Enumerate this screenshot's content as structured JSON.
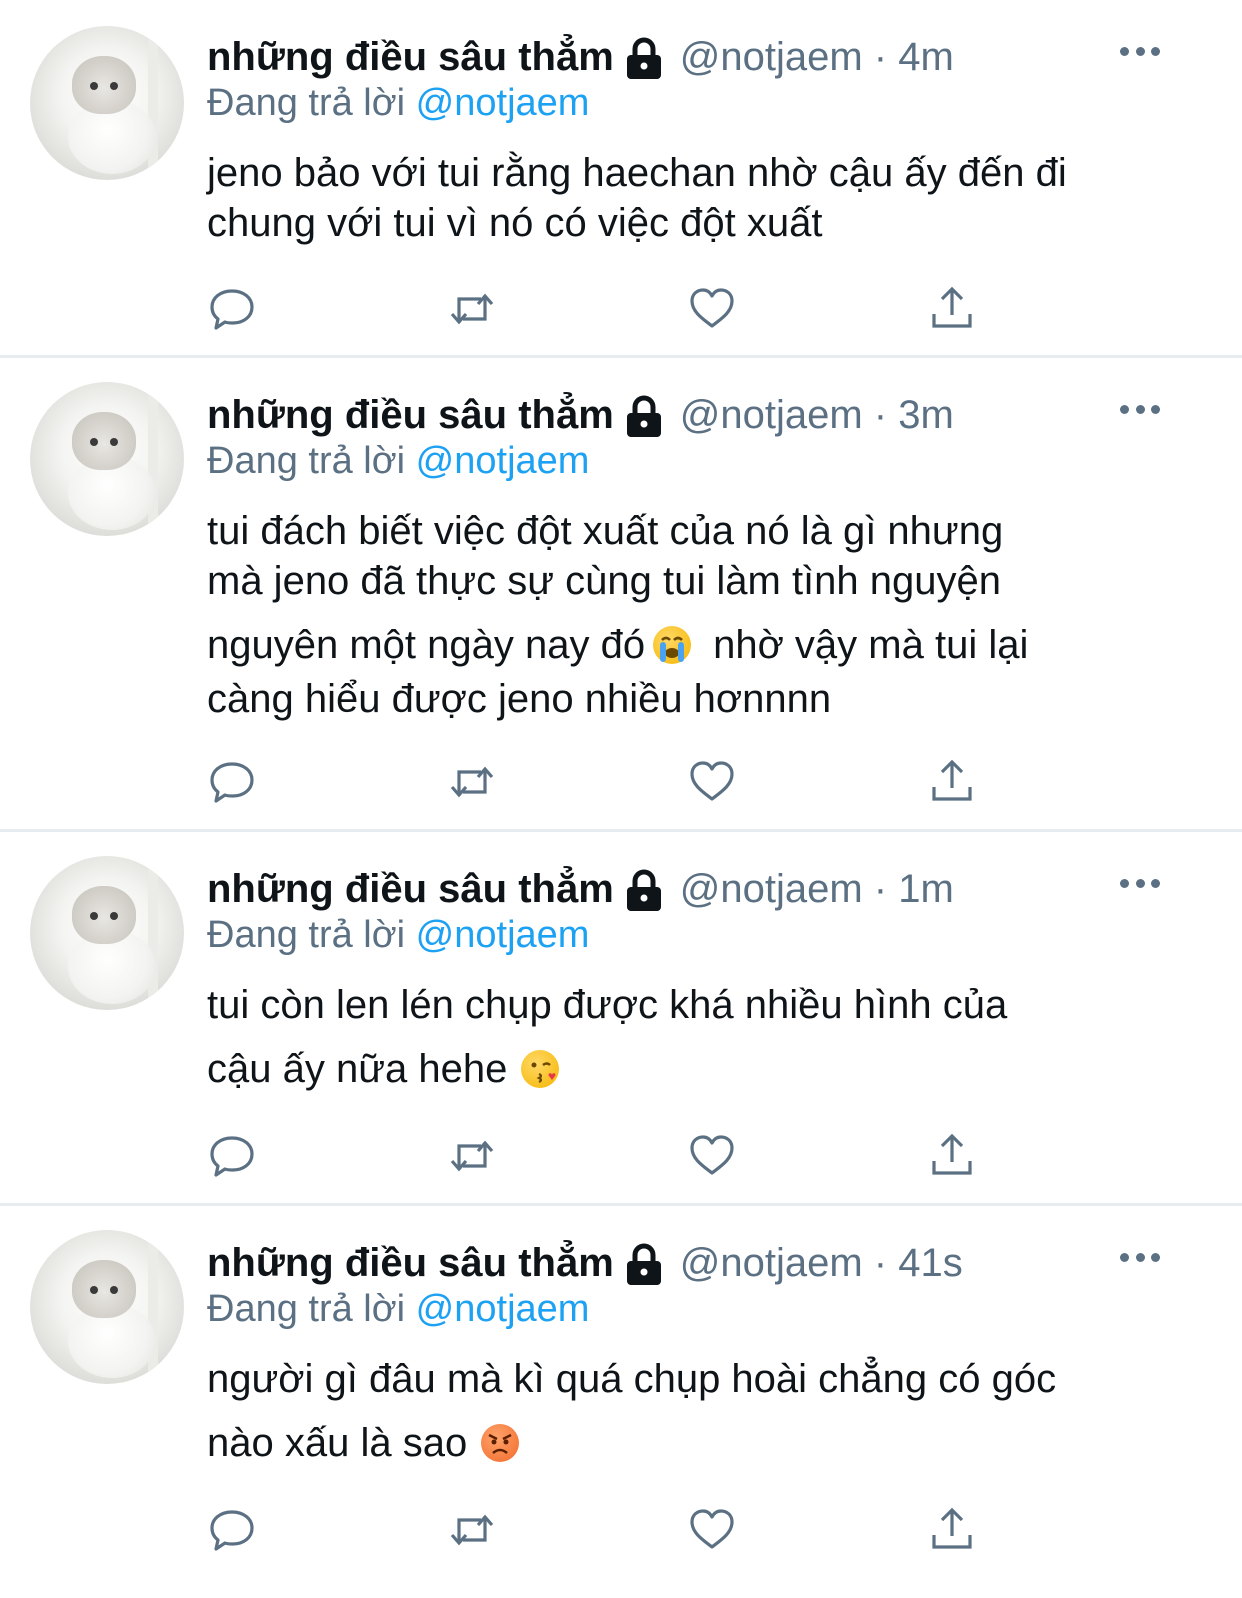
{
  "tweets": [
    {
      "name": "những điều sâu thẳm",
      "handle_time": "@notjaem · 4m",
      "reply_prefix": "Đang trả lời",
      "reply_mention": "@notjaem",
      "lines": [
        "jeno bảo với tui rằng haechan nhờ cậu ấy đến đi",
        "chung với tui vì nó có việc đột xuất"
      ],
      "emoji": ""
    },
    {
      "name": "những điều sâu thẳm",
      "handle_time": "@notjaem · 3m",
      "reply_prefix": "Đang trả lời",
      "reply_mention": "@notjaem",
      "lines": [
        "tui đách biết việc đột xuất của nó là gì nhưng",
        "mà jeno đã thực sự cùng tui làm tình nguyện",
        "nguyên một ngày nay đó",
        "nhờ vậy mà tui lại",
        "càng hiểu được jeno nhiều hơnnnn"
      ],
      "emoji": "loudly-crying-face"
    },
    {
      "name": "những điều sâu thẳm",
      "handle_time": "@notjaem · 1m",
      "reply_prefix": "Đang trả lời",
      "reply_mention": "@notjaem",
      "lines": [
        "tui còn len lén chụp được khá nhiều hình của",
        "cậu ấy nữa hehe"
      ],
      "emoji": "face-blowing-kiss"
    },
    {
      "name": "những điều sâu thẳm",
      "handle_time": "@notjaem · 41s",
      "reply_prefix": "Đang trả lời",
      "reply_mention": "@notjaem",
      "lines": [
        "người gì đâu mà kì quá chụp hoài chẳng có góc",
        "nào xấu là sao"
      ],
      "emoji": "angry-face"
    }
  ],
  "colors": {
    "text": "#0f1419",
    "secondary": "#5b7083",
    "mention": "#1da1f2",
    "divider": "#e6ecf0"
  },
  "icons": [
    "reply-icon",
    "retweet-icon",
    "like-icon",
    "share-icon",
    "more-icon",
    "lock-icon"
  ]
}
